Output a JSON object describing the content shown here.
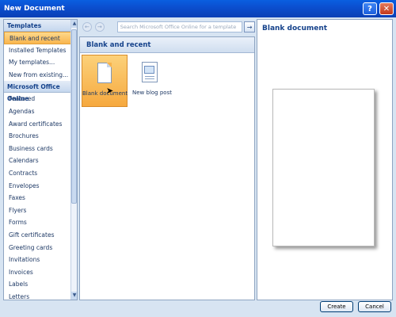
{
  "window": {
    "title": "New Document"
  },
  "title_buttons": {
    "help": "?",
    "close": "✕"
  },
  "left": {
    "templates_header": "Templates",
    "template_items": [
      {
        "label": "Blank and recent",
        "selected": true
      },
      {
        "label": "Installed Templates"
      },
      {
        "label": "My templates..."
      },
      {
        "label": "New from existing..."
      }
    ],
    "online_header": "Microsoft Office Online",
    "online_items": [
      "Featured",
      "Agendas",
      "Award certificates",
      "Brochures",
      "Business cards",
      "Calendars",
      "Contracts",
      "Envelopes",
      "Faxes",
      "Flyers",
      "Forms",
      "Gift certificates",
      "Greeting cards",
      "Invitations",
      "Invoices",
      "Labels",
      "Letters"
    ]
  },
  "nav": {
    "back": "←",
    "forward": "→",
    "search_placeholder": "Search Microsoft Office Online for a template",
    "go": "→"
  },
  "middle": {
    "heading": "Blank and recent",
    "tiles": [
      {
        "label": "Blank document",
        "icon": "blank-document-icon",
        "selected": true
      },
      {
        "label": "New blog post",
        "icon": "blog-post-icon"
      }
    ]
  },
  "preview": {
    "title": "Blank document"
  },
  "buttons": {
    "create": "Create",
    "cancel": "Cancel"
  },
  "colors": {
    "title_bar": "#0a5fe0",
    "selection": "#f9b54e",
    "heading_text": "#15428b"
  }
}
